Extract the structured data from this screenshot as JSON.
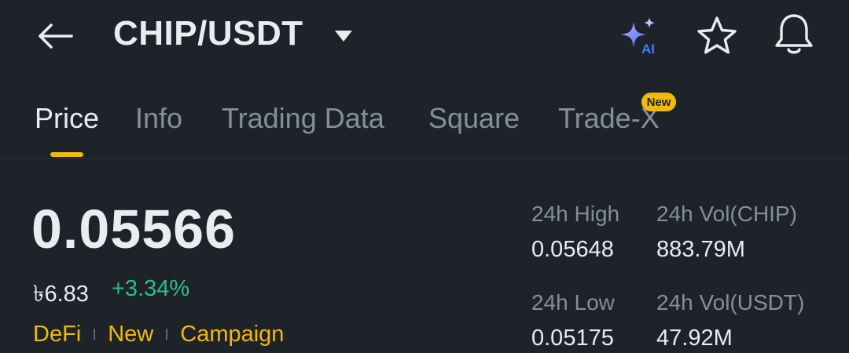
{
  "header": {
    "title": "CHIP/USDT",
    "back_icon": "arrow-left-icon",
    "ai_icon": "ai-sparkle-icon",
    "ai_label": "AI",
    "favorite_icon": "star-icon",
    "alert_icon": "bell-icon"
  },
  "tabs": [
    {
      "label": "Price",
      "active": true
    },
    {
      "label": "Info",
      "active": false
    },
    {
      "label": "Trading Data",
      "active": false
    },
    {
      "label": "Square",
      "active": false
    },
    {
      "label": "Trade-X",
      "active": false,
      "badge": "New"
    }
  ],
  "price": {
    "last": "0.05566",
    "local": "৳6.83",
    "change": "+3.34%"
  },
  "tags": [
    "DeFi",
    "New",
    "Campaign"
  ],
  "stats": {
    "high": {
      "label": "24h High",
      "value": "0.05648"
    },
    "vol_base": {
      "label": "24h Vol(CHIP)",
      "value": "883.79M"
    },
    "low": {
      "label": "24h Low",
      "value": "0.05175"
    },
    "vol_quote": {
      "label": "24h Vol(USDT)",
      "value": "47.92M"
    }
  },
  "colors": {
    "background": "#1e2329",
    "accent": "#f0b90b",
    "positive": "#2ebd85",
    "muted": "#848e9c",
    "text": "#eaecef"
  }
}
